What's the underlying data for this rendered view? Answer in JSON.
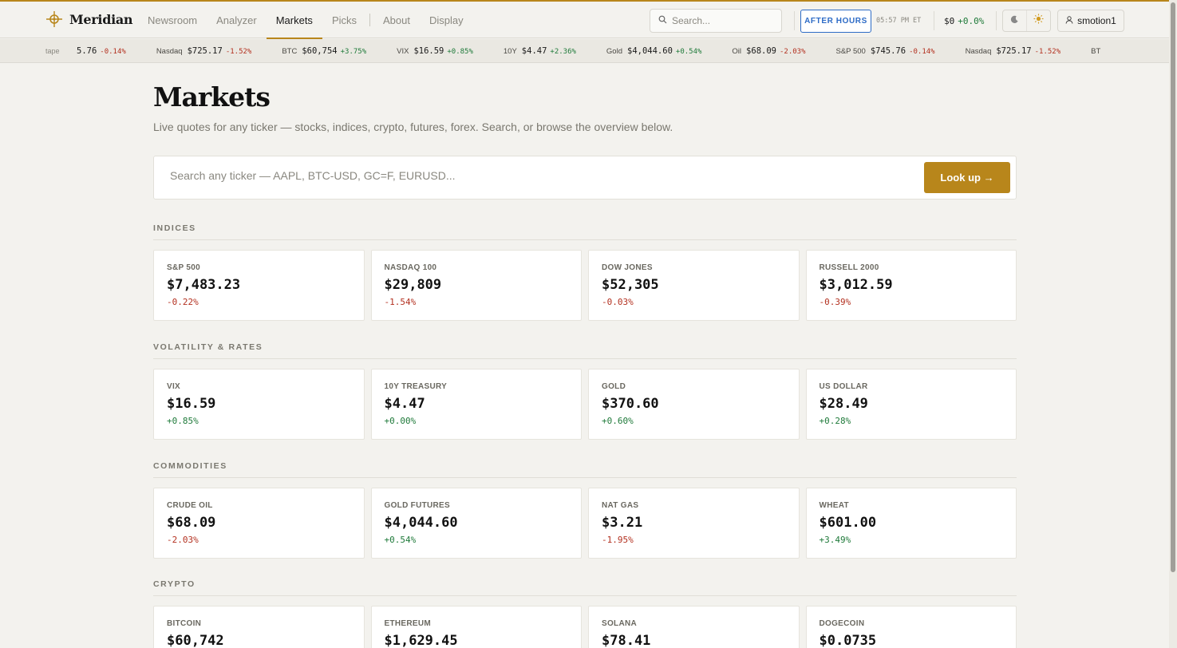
{
  "brand": {
    "name": "Meridian"
  },
  "nav": [
    {
      "label": "Newsroom",
      "active": false
    },
    {
      "label": "Analyzer",
      "active": false
    },
    {
      "label": "Markets",
      "active": true
    },
    {
      "label": "Picks",
      "active": false
    },
    {
      "label": "About",
      "active": false
    },
    {
      "label": "Display",
      "active": false
    }
  ],
  "header": {
    "search_placeholder": "Search...",
    "session_badge": "AFTER HOURS",
    "clock": "05:57 PM ET",
    "balance": "$0",
    "balance_change": "+0.0%",
    "username": "smotion1"
  },
  "tape": {
    "label": "tape",
    "items": [
      {
        "sym": "",
        "price": "5.76",
        "chg": "-0.14%",
        "dir": "neg"
      },
      {
        "sym": "Nasdaq",
        "price": "$725.17",
        "chg": "-1.52%",
        "dir": "neg"
      },
      {
        "sym": "BTC",
        "price": "$60,754",
        "chg": "+3.75%",
        "dir": "pos"
      },
      {
        "sym": "VIX",
        "price": "$16.59",
        "chg": "+0.85%",
        "dir": "pos"
      },
      {
        "sym": "10Y",
        "price": "$4.47",
        "chg": "+2.36%",
        "dir": "pos"
      },
      {
        "sym": "Gold",
        "price": "$4,044.60",
        "chg": "+0.54%",
        "dir": "pos"
      },
      {
        "sym": "Oil",
        "price": "$68.09",
        "chg": "-2.03%",
        "dir": "neg"
      },
      {
        "sym": "S&P 500",
        "price": "$745.76",
        "chg": "-0.14%",
        "dir": "neg"
      },
      {
        "sym": "Nasdaq",
        "price": "$725.17",
        "chg": "-1.52%",
        "dir": "neg"
      },
      {
        "sym": "BT",
        "price": "",
        "chg": "",
        "dir": "pos"
      }
    ]
  },
  "page": {
    "title": "Markets",
    "subtitle": "Live quotes for any ticker — stocks, indices, crypto, futures, forex. Search, or browse the overview below.",
    "lookup_placeholder": "Search any ticker — AAPL, BTC-USD, GC=F, EURUSD...",
    "lookup_button": "Look up →"
  },
  "sections": [
    {
      "label": "INDICES",
      "cards": [
        {
          "name": "S&P 500",
          "price": "$7,483.23",
          "chg": "-0.22%",
          "dir": "neg"
        },
        {
          "name": "NASDAQ 100",
          "price": "$29,809",
          "chg": "-1.54%",
          "dir": "neg"
        },
        {
          "name": "DOW JONES",
          "price": "$52,305",
          "chg": "-0.03%",
          "dir": "neg"
        },
        {
          "name": "RUSSELL 2000",
          "price": "$3,012.59",
          "chg": "-0.39%",
          "dir": "neg"
        }
      ]
    },
    {
      "label": "VOLATILITY & RATES",
      "cards": [
        {
          "name": "VIX",
          "price": "$16.59",
          "chg": "+0.85%",
          "dir": "pos"
        },
        {
          "name": "10Y TREASURY",
          "price": "$4.47",
          "chg": "+0.00%",
          "dir": "pos"
        },
        {
          "name": "GOLD",
          "price": "$370.60",
          "chg": "+0.60%",
          "dir": "pos"
        },
        {
          "name": "US DOLLAR",
          "price": "$28.49",
          "chg": "+0.28%",
          "dir": "pos"
        }
      ]
    },
    {
      "label": "COMMODITIES",
      "cards": [
        {
          "name": "CRUDE OIL",
          "price": "$68.09",
          "chg": "-2.03%",
          "dir": "neg"
        },
        {
          "name": "GOLD FUTURES",
          "price": "$4,044.60",
          "chg": "+0.54%",
          "dir": "pos"
        },
        {
          "name": "NAT GAS",
          "price": "$3.21",
          "chg": "-1.95%",
          "dir": "neg"
        },
        {
          "name": "WHEAT",
          "price": "$601.00",
          "chg": "+3.49%",
          "dir": "pos"
        }
      ]
    },
    {
      "label": "CRYPTO",
      "cards": [
        {
          "name": "BITCOIN",
          "price": "$60,742",
          "chg": "",
          "dir": "pos"
        },
        {
          "name": "ETHEREUM",
          "price": "$1,629.45",
          "chg": "",
          "dir": "pos"
        },
        {
          "name": "SOLANA",
          "price": "$78.41",
          "chg": "",
          "dir": "pos"
        },
        {
          "name": "DOGECOIN",
          "price": "$0.0735",
          "chg": "",
          "dir": "pos"
        }
      ]
    }
  ],
  "colors": {
    "accent": "#b8861b",
    "positive": "#1f7a3a",
    "negative": "#b3301f",
    "session": "#2d6bc6"
  },
  "icons": {
    "logo": "compass-crosshair-icon",
    "search": "search-icon",
    "dark_mode": "moon-icon",
    "light_mode": "sun-icon",
    "user": "user-icon"
  }
}
